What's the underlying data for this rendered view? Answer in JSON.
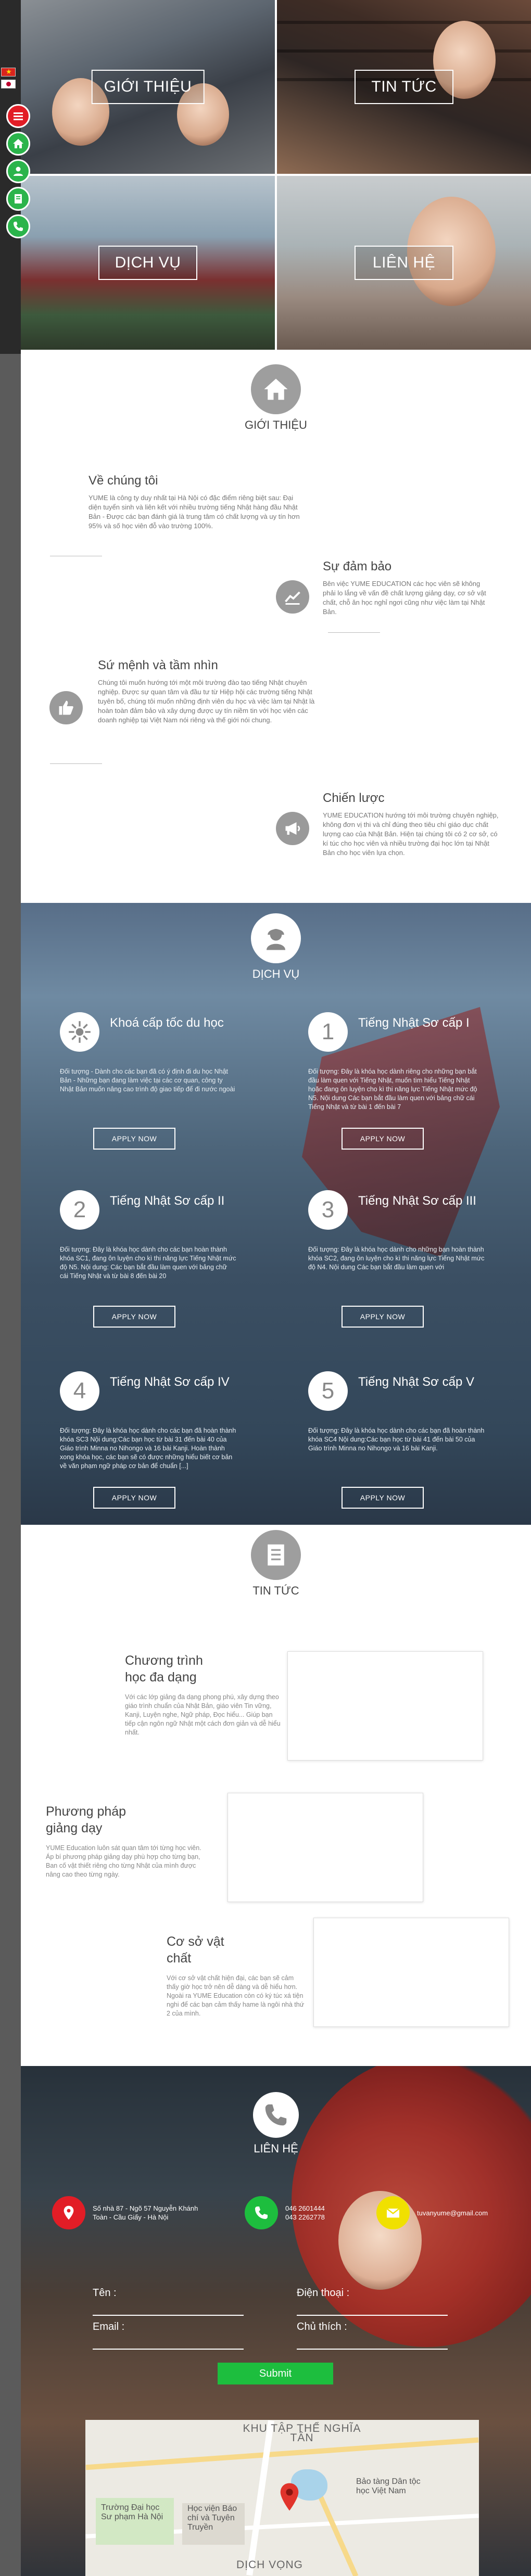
{
  "flags": {
    "vietnamese": "vn-flag-icon",
    "japanese": "jp-flag-icon"
  },
  "side_nav": [
    {
      "name": "menu",
      "icon": "menu-icon",
      "color": "#e21d26"
    },
    {
      "name": "home",
      "icon": "home-icon",
      "color": "#2bb44b"
    },
    {
      "name": "user",
      "icon": "user-icon",
      "color": "#2bb44b"
    },
    {
      "name": "book",
      "icon": "book-icon",
      "color": "#2bb44b"
    },
    {
      "name": "phone",
      "icon": "phone-icon",
      "color": "#2bb44b"
    }
  ],
  "hero": {
    "intro": "GIỚI THIỆU",
    "news": "TIN TỨC",
    "services": "DỊCH VỤ",
    "contact": "LIÊN HỆ"
  },
  "about": {
    "title": "GIỚI THIỆU",
    "blocks": [
      {
        "heading": "Về chúng tôi",
        "text": "YUME là công ty duy nhất tại Hà Nội có đặc điểm riêng biệt sau: Đại diện tuyển sinh và liên kết với nhiều trường tiếng Nhật hàng đầu Nhật Bản - Được các bạn đánh giá là trung tâm có chất lượng và uy tín hơn 95% và số học viên đỗ vào trường 100%."
      },
      {
        "heading": "Sự đảm bảo",
        "text": "Bên việc YUME EDUCATION các học viên sẽ không phải lo lắng về vấn đề chất lượng giảng dạy, cơ sở vật chất, chỗ ăn học nghỉ ngơi cũng như việc làm tại Nhật Bản."
      },
      {
        "heading": "Sứ mệnh và tầm nhìn",
        "text": "Chúng tôi muốn hướng tới một môi trường đào tạo tiếng Nhật chuyên nghiệp. Được sự quan tâm và đầu tư từ Hiệp hội các trường tiếng Nhật tuyên bố, chúng tôi muốn những định viên du học và việc làm tại Nhật là hoàn toàn đảm bảo và xây dựng được uy tín niềm tin với học viên các doanh nghiệp tại Việt Nam nói riêng và thế giới nói chung."
      },
      {
        "heading": "Chiến lược",
        "text": "YUME EDUCATION hướng tới môi trường chuyên nghiệp, không đơn vị thi và chỉ đúng theo tiêu chí giáo dục chất lượng cao của Nhật Bản. Hiện tại chúng tôi có 2 cơ sở, có kí túc cho học viên và nhiều trường đại học lớn tại Nhật Bản cho học viên lựa chọn."
      }
    ]
  },
  "services": {
    "title": "DỊCH VỤ",
    "apply_label": "APPLY NOW",
    "items": [
      {
        "badge": "",
        "icon": "sun-icon",
        "title": "Khoá cấp tốc du học",
        "text": "Đối tượng - Dành cho các bạn đã có ý định đi du học Nhật Bản - Những bạn đang làm việc tại các cơ quan, công ty Nhật Bản muốn nâng cao trình độ giao tiếp để đi nước ngoài"
      },
      {
        "badge": "1",
        "icon": "",
        "title": "Tiếng Nhật Sơ cấp I",
        "text": "Đối tượng: Đây là khóa học dành riêng cho những bạn bắt đầu làm quen với Tiếng Nhật, muốn tìm hiểu Tiếng Nhật hoặc đang ôn luyện cho kì thi năng lực Tiếng Nhật mức độ N5. Nội dung Các bạn bắt đầu làm quen với bảng chữ cái Tiếng Nhật và từ bài 1 đến bài 7"
      },
      {
        "badge": "2",
        "icon": "",
        "title": "Tiếng Nhật Sơ cấp II",
        "text": "Đối tượng: Đây là khóa học dành cho các bạn hoàn thành khóa SC1, đang ôn luyện cho kì thi năng lực Tiếng Nhật mức độ N5. Nội dung: Các bạn bắt đầu làm quen với bảng chữ cái Tiếng Nhật và từ bài 8 đến bài 20"
      },
      {
        "badge": "3",
        "icon": "",
        "title": "Tiếng Nhật Sơ cấp III",
        "text": "Đối tượng: Đây là khóa học dành cho những bạn hoàn thành khóa SC2, đang ôn luyện cho kì thi năng lực Tiếng Nhật mức độ N4. Nội dung Các bạn bắt đầu làm quen với"
      },
      {
        "badge": "4",
        "icon": "",
        "title": "Tiếng Nhật Sơ cấp IV",
        "text": "Đối tượng: Đây là khóa học dành cho các bạn đã hoàn thành khóa SC3 Nội dung:Các bạn học từ bài 31 đến bài 40 của Giáo trình Minna no Nihongo và 16 bài Kanji. Hoàn thành xong khóa học, các bạn sẽ có được những hiểu biết cơ bản về văn phạm ngữ pháp cơ bản để chuẩn [...]"
      },
      {
        "badge": "5",
        "icon": "",
        "title": "Tiếng Nhật Sơ cấp V",
        "text": "Đối tượng: Đây là khóa học dành cho các bạn đã hoàn thành khóa SC4 Nội dung:Các bạn học từ bài 41 đến bài 50 của Giáo trình Minna no Nihongo và 16 bài Kanji."
      }
    ]
  },
  "news": {
    "title": "TIN TỨC",
    "items": [
      {
        "heading": "Chương trình học đa dạng",
        "text": "Với các lớp giảng đa dạng phong phú, xây dựng theo giáo trình chuẩn của Nhật Bản, giáo viên Tin vững, Kanji, Luyện nghe, Ngữ pháp, Đọc hiểu... Giúp bạn tiếp cận ngôn ngữ Nhật một cách đơn giản và dễ hiểu nhất."
      },
      {
        "heading": "Phương pháp giảng dạy",
        "text": "YUME Education luôn sát quan tâm tới từng học viên. Áp bí phương pháp giảng dạy phù hợp cho từng bạn, Ban cố vật thiết riêng cho từng Nhật của mình được nâng cao theo từng ngày."
      },
      {
        "heading": "Cơ sở vật chất",
        "text": "Với cơ sở vật chất hiện đại, các bạn sẽ cảm thấy giờ học trở nên dễ dàng và dễ hiểu hơn. Ngoài ra YUME Education còn có ký túc xá tiện nghi để các bạn cảm thấy hame là ngôi nhà thứ 2 của mình."
      }
    ]
  },
  "contact": {
    "title": "LIÊN HỆ",
    "address": "Số nhà 87 - Ngõ 57 Nguyễn Khánh Toàn - Cầu Giấy - Hà Nội",
    "phone1": "046 2601444",
    "phone2": "043 2262778",
    "email": "tuvanyume@gmail.com",
    "name_label": "Tên :",
    "phone_label": "Điện thoại :",
    "email_label": "Email :",
    "subject_label": "Chủ thích :",
    "submit_label": "Submit",
    "map": {
      "area": "KHU TẬP THỂ NGHĨA TÂN",
      "place1": "Bảo tàng Dân tộc học Việt Nam",
      "place2": "Trường Đại học Sư phạm Hà Nội",
      "place3": "Học viện Báo chí và Tuyên Truyền",
      "place4": "DỊCH VỌNG"
    }
  }
}
